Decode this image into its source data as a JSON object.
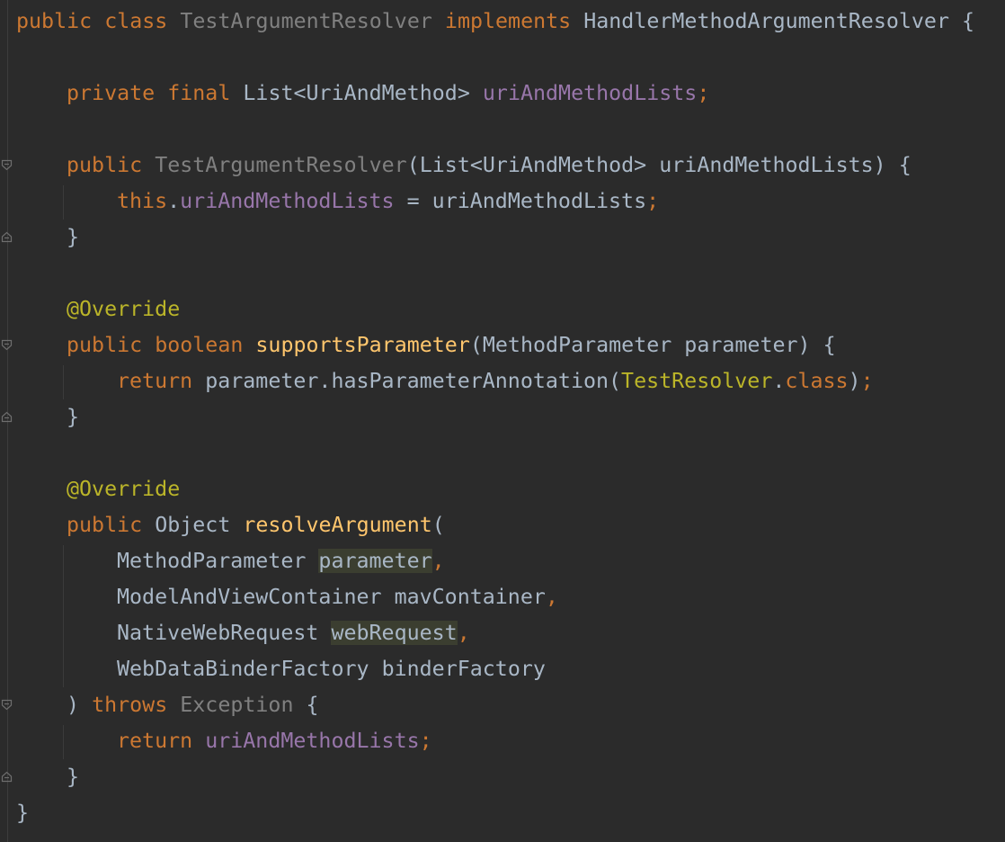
{
  "colors": {
    "background": "#2b2b2b",
    "keyword": "#cc7832",
    "plain": "#a9b7c6",
    "field": "#9876aa",
    "method": "#ffc66d",
    "annotation": "#bbb529",
    "unused": "#808080",
    "highlight": "#3b3e30"
  },
  "code": {
    "l1": {
      "kw1": "public",
      "kw2": "class",
      "name": "TestArgumentResolver",
      "kw3": "implements",
      "iface": "HandlerMethodArgumentResolver",
      "brace": "{"
    },
    "l3": {
      "kw1": "private",
      "kw2": "final",
      "type": "List<UriAndMethod>",
      "field": "uriAndMethodLists",
      "semi": ";"
    },
    "l5": {
      "kw1": "public",
      "ctor": "TestArgumentResolver",
      "params": "(List<UriAndMethod> uriAndMethodLists) {"
    },
    "l6": {
      "kw1": "this",
      "dot": ".",
      "field": "uriAndMethodLists",
      "rest": " = uriAndMethodLists",
      "semi": ";"
    },
    "l7": {
      "brace": "}"
    },
    "l9": {
      "annotation": "@Override"
    },
    "l10": {
      "kw1": "public",
      "kw2": "boolean",
      "method": "supportsParameter",
      "params": "(MethodParameter parameter) {"
    },
    "l11": {
      "kw1": "return",
      "call": "parameter.hasParameterAnnotation(",
      "annotype": "TestResolver",
      "dot": ".",
      "kw2": "class",
      "close": ")",
      "semi": ";"
    },
    "l12": {
      "brace": "}"
    },
    "l14": {
      "annotation": "@Override"
    },
    "l15": {
      "kw1": "public",
      "type": "Object",
      "method": "resolveArgument",
      "paren": "("
    },
    "l16": {
      "type": "MethodParameter",
      "param": "parameter",
      "comma": ","
    },
    "l17": {
      "type": "ModelAndViewContainer",
      "param": "mavContainer",
      "comma": ","
    },
    "l18": {
      "type": "NativeWebRequest",
      "param": "webRequest",
      "comma": ","
    },
    "l19": {
      "type": "WebDataBinderFactory",
      "param": "binderFactory"
    },
    "l20": {
      "paren": ")",
      "kw1": "throws",
      "exc": "Exception",
      "brace": "{"
    },
    "l21": {
      "kw1": "return",
      "field": "uriAndMethodLists",
      "semi": ";"
    },
    "l22": {
      "brace": "}"
    },
    "l23": {
      "brace": "}"
    }
  }
}
